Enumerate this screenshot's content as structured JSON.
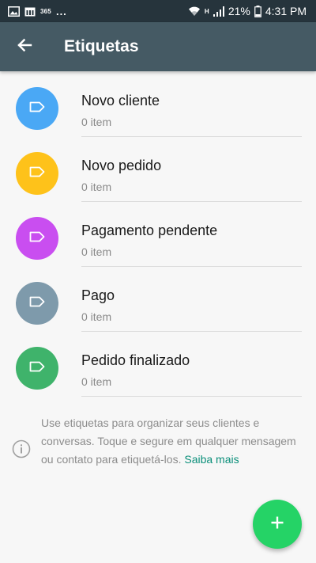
{
  "status_bar": {
    "carrier_badge": "365",
    "more_indicator": "...",
    "network_letter": "H",
    "battery_percent": "21%",
    "time": "4:31 PM",
    "icons": [
      "gallery-icon",
      "calendar-icon",
      "wifi-icon",
      "signal-icon",
      "battery-icon"
    ]
  },
  "app_bar": {
    "back_icon": "arrow-back-icon",
    "title": "Etiquetas"
  },
  "labels": [
    {
      "name": "Novo cliente",
      "count": "0 item",
      "color": "#4aa8f5",
      "icon": "tag-icon"
    },
    {
      "name": "Novo pedido",
      "count": "0 item",
      "color": "#fec21a",
      "icon": "tag-icon"
    },
    {
      "name": "Pagamento pendente",
      "count": "0 item",
      "color": "#c94ef0",
      "icon": "tag-icon"
    },
    {
      "name": "Pago",
      "count": "0 item",
      "color": "#7e9aab",
      "icon": "tag-icon"
    },
    {
      "name": "Pedido finalizado",
      "count": "0 item",
      "color": "#3fb36b",
      "icon": "tag-icon"
    }
  ],
  "info": {
    "icon": "info-icon",
    "text": "Use etiquetas para organizar seus clientes e conversas. Toque e segure em qualquer mensagem ou contato para etiquetá-los.",
    "link": "Saiba mais"
  },
  "fab": {
    "icon": "plus-icon",
    "color": "#25d366"
  }
}
